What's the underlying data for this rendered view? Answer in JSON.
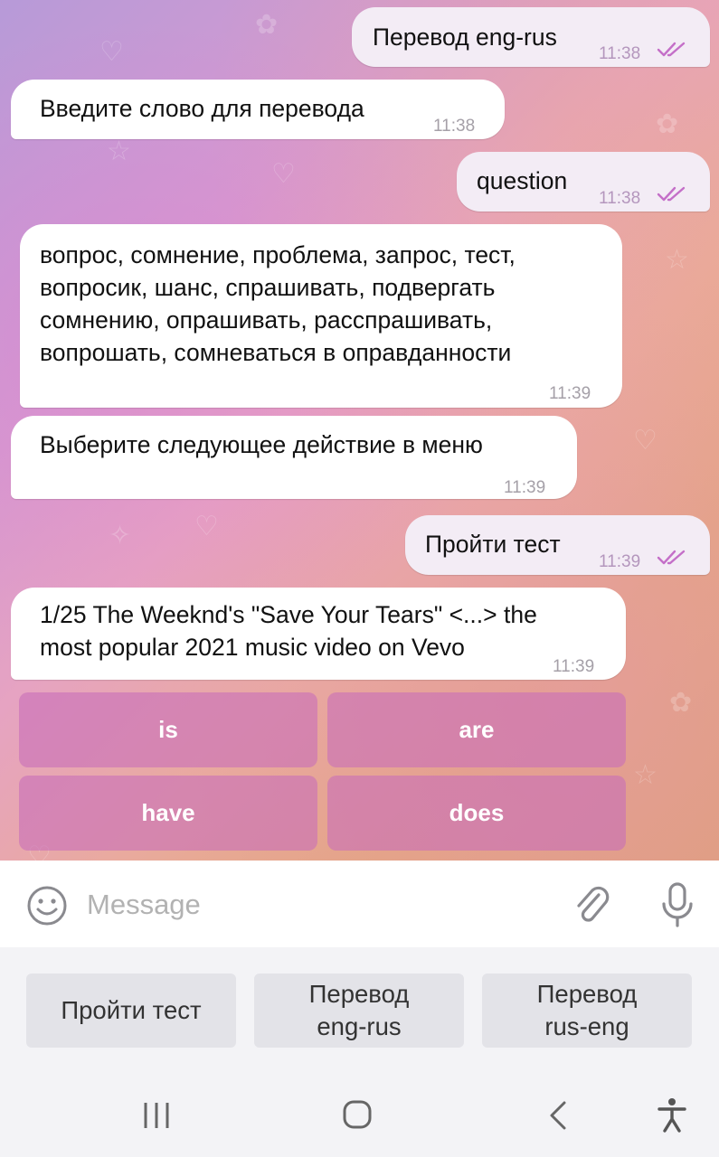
{
  "messages": [
    {
      "direction": "outgoing",
      "text": "Перевод eng-rus",
      "time": "11:38",
      "status": "read"
    },
    {
      "direction": "incoming",
      "text": "Введите слово для перевода",
      "time": "11:38"
    },
    {
      "direction": "outgoing",
      "text": "question",
      "time": "11:38",
      "status": "read"
    },
    {
      "direction": "incoming",
      "lines": [
        "вопрос, сомнение, проблема, запрос, тест,",
        "вопросик, шанс, спрашивать, подвергать",
        "сомнению, опрашивать, расспрашивать,",
        "вопрошать, сомневаться в оправданности"
      ],
      "time": "11:39"
    },
    {
      "direction": "incoming",
      "text": "Выберите следующее действие в меню",
      "time": "11:39"
    },
    {
      "direction": "outgoing",
      "text": "Пройти тест",
      "time": "11:39",
      "status": "read"
    },
    {
      "direction": "incoming",
      "lines": [
        "1/25 The Weeknd's \"Save Your Tears\" <...> the",
        "most popular 2021 music video on Vevo"
      ],
      "time": "11:39"
    }
  ],
  "inline_keyboard": [
    "is",
    "are",
    "have",
    "does"
  ],
  "input": {
    "placeholder": "Message",
    "value": ""
  },
  "reply_keyboard": [
    {
      "lines": [
        "Пройти тест"
      ]
    },
    {
      "lines": [
        "Перевод",
        "eng-rus"
      ]
    },
    {
      "lines": [
        "Перевод",
        "rus-eng"
      ]
    }
  ],
  "icons": {
    "emoji": "smiley-icon",
    "attach": "paperclip-icon",
    "voice": "microphone-icon",
    "read_receipt": "double-check-icon",
    "nav_recent": "recent-apps-icon",
    "nav_home": "home-icon",
    "nav_back": "back-icon",
    "nav_accessibility": "accessibility-icon"
  },
  "colors": {
    "outgoing_bubble": "#f3ecf5",
    "incoming_bubble": "#ffffff",
    "read_check": "#c46fc8",
    "inline_button": "#c86eb9"
  }
}
